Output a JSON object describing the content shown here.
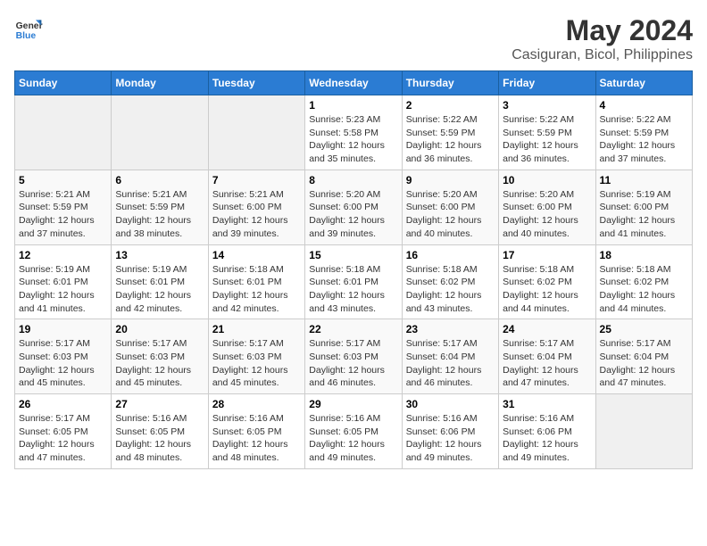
{
  "logo": {
    "line1": "General",
    "line2": "Blue"
  },
  "title": "May 2024",
  "subtitle": "Casiguran, Bicol, Philippines",
  "headers": [
    "Sunday",
    "Monday",
    "Tuesday",
    "Wednesday",
    "Thursday",
    "Friday",
    "Saturday"
  ],
  "weeks": [
    [
      {
        "day": "",
        "info": ""
      },
      {
        "day": "",
        "info": ""
      },
      {
        "day": "",
        "info": ""
      },
      {
        "day": "1",
        "info": "Sunrise: 5:23 AM\nSunset: 5:58 PM\nDaylight: 12 hours\nand 35 minutes."
      },
      {
        "day": "2",
        "info": "Sunrise: 5:22 AM\nSunset: 5:59 PM\nDaylight: 12 hours\nand 36 minutes."
      },
      {
        "day": "3",
        "info": "Sunrise: 5:22 AM\nSunset: 5:59 PM\nDaylight: 12 hours\nand 36 minutes."
      },
      {
        "day": "4",
        "info": "Sunrise: 5:22 AM\nSunset: 5:59 PM\nDaylight: 12 hours\nand 37 minutes."
      }
    ],
    [
      {
        "day": "5",
        "info": "Sunrise: 5:21 AM\nSunset: 5:59 PM\nDaylight: 12 hours\nand 37 minutes."
      },
      {
        "day": "6",
        "info": "Sunrise: 5:21 AM\nSunset: 5:59 PM\nDaylight: 12 hours\nand 38 minutes."
      },
      {
        "day": "7",
        "info": "Sunrise: 5:21 AM\nSunset: 6:00 PM\nDaylight: 12 hours\nand 39 minutes."
      },
      {
        "day": "8",
        "info": "Sunrise: 5:20 AM\nSunset: 6:00 PM\nDaylight: 12 hours\nand 39 minutes."
      },
      {
        "day": "9",
        "info": "Sunrise: 5:20 AM\nSunset: 6:00 PM\nDaylight: 12 hours\nand 40 minutes."
      },
      {
        "day": "10",
        "info": "Sunrise: 5:20 AM\nSunset: 6:00 PM\nDaylight: 12 hours\nand 40 minutes."
      },
      {
        "day": "11",
        "info": "Sunrise: 5:19 AM\nSunset: 6:00 PM\nDaylight: 12 hours\nand 41 minutes."
      }
    ],
    [
      {
        "day": "12",
        "info": "Sunrise: 5:19 AM\nSunset: 6:01 PM\nDaylight: 12 hours\nand 41 minutes."
      },
      {
        "day": "13",
        "info": "Sunrise: 5:19 AM\nSunset: 6:01 PM\nDaylight: 12 hours\nand 42 minutes."
      },
      {
        "day": "14",
        "info": "Sunrise: 5:18 AM\nSunset: 6:01 PM\nDaylight: 12 hours\nand 42 minutes."
      },
      {
        "day": "15",
        "info": "Sunrise: 5:18 AM\nSunset: 6:01 PM\nDaylight: 12 hours\nand 43 minutes."
      },
      {
        "day": "16",
        "info": "Sunrise: 5:18 AM\nSunset: 6:02 PM\nDaylight: 12 hours\nand 43 minutes."
      },
      {
        "day": "17",
        "info": "Sunrise: 5:18 AM\nSunset: 6:02 PM\nDaylight: 12 hours\nand 44 minutes."
      },
      {
        "day": "18",
        "info": "Sunrise: 5:18 AM\nSunset: 6:02 PM\nDaylight: 12 hours\nand 44 minutes."
      }
    ],
    [
      {
        "day": "19",
        "info": "Sunrise: 5:17 AM\nSunset: 6:03 PM\nDaylight: 12 hours\nand 45 minutes."
      },
      {
        "day": "20",
        "info": "Sunrise: 5:17 AM\nSunset: 6:03 PM\nDaylight: 12 hours\nand 45 minutes."
      },
      {
        "day": "21",
        "info": "Sunrise: 5:17 AM\nSunset: 6:03 PM\nDaylight: 12 hours\nand 45 minutes."
      },
      {
        "day": "22",
        "info": "Sunrise: 5:17 AM\nSunset: 6:03 PM\nDaylight: 12 hours\nand 46 minutes."
      },
      {
        "day": "23",
        "info": "Sunrise: 5:17 AM\nSunset: 6:04 PM\nDaylight: 12 hours\nand 46 minutes."
      },
      {
        "day": "24",
        "info": "Sunrise: 5:17 AM\nSunset: 6:04 PM\nDaylight: 12 hours\nand 47 minutes."
      },
      {
        "day": "25",
        "info": "Sunrise: 5:17 AM\nSunset: 6:04 PM\nDaylight: 12 hours\nand 47 minutes."
      }
    ],
    [
      {
        "day": "26",
        "info": "Sunrise: 5:17 AM\nSunset: 6:05 PM\nDaylight: 12 hours\nand 47 minutes."
      },
      {
        "day": "27",
        "info": "Sunrise: 5:16 AM\nSunset: 6:05 PM\nDaylight: 12 hours\nand 48 minutes."
      },
      {
        "day": "28",
        "info": "Sunrise: 5:16 AM\nSunset: 6:05 PM\nDaylight: 12 hours\nand 48 minutes."
      },
      {
        "day": "29",
        "info": "Sunrise: 5:16 AM\nSunset: 6:05 PM\nDaylight: 12 hours\nand 49 minutes."
      },
      {
        "day": "30",
        "info": "Sunrise: 5:16 AM\nSunset: 6:06 PM\nDaylight: 12 hours\nand 49 minutes."
      },
      {
        "day": "31",
        "info": "Sunrise: 5:16 AM\nSunset: 6:06 PM\nDaylight: 12 hours\nand 49 minutes."
      },
      {
        "day": "",
        "info": ""
      }
    ]
  ]
}
